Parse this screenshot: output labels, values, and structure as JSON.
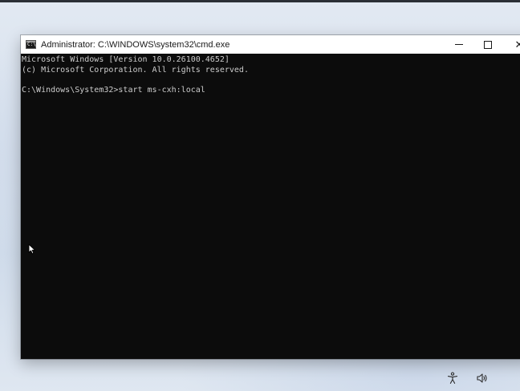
{
  "window": {
    "title": "Administrator: C:\\WINDOWS\\system32\\cmd.exe",
    "app_icon_glyph": "C:\\",
    "icon": "cmd-icon"
  },
  "caption_buttons": {
    "minimize_icon": "minimize-icon",
    "maximize_icon": "maximize-icon",
    "close_icon": "close-icon",
    "close_glyph": "✕"
  },
  "console": {
    "lines": [
      "Microsoft Windows [Version 10.0.26100.4652]",
      "(c) Microsoft Corporation. All rights reserved.",
      "",
      "C:\\Windows\\System32>start ms-cxh:local"
    ],
    "text_color": "#cccccc",
    "background_color": "#0c0c0c"
  },
  "taskbar": {
    "accessibility_icon": "accessibility-icon",
    "volume_icon": "volume-icon"
  }
}
